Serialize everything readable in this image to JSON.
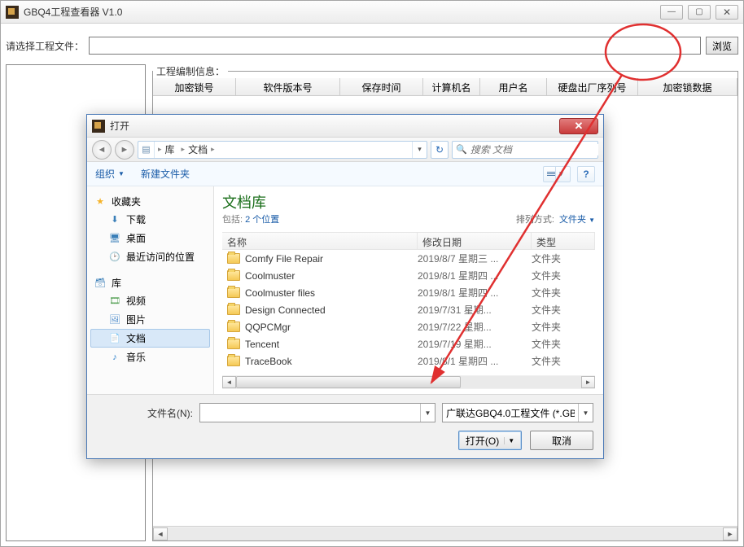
{
  "app": {
    "title": "GBQ4工程查看器 V1.0",
    "pick_label": "请选择工程文件：",
    "pick_value": "",
    "browse": "浏览"
  },
  "info_legend": "工程编制信息：",
  "grid_headers": [
    "加密锁号",
    "软件版本号",
    "保存时间",
    "计算机名",
    "用户名",
    "硬盘出厂序列号",
    "加密锁数据"
  ],
  "dialog": {
    "title": "打开",
    "breadcrumb": {
      "root": "库",
      "current": "文档"
    },
    "search_placeholder": "搜索 文档",
    "organize": "组织",
    "new_folder": "新建文件夹",
    "nav": {
      "favorites": "收藏夹",
      "downloads": "下载",
      "desktop": "桌面",
      "recent": "最近访问的位置",
      "libraries": "库",
      "videos": "视频",
      "pictures": "图片",
      "documents": "文档",
      "music": "音乐"
    },
    "lib_title": "文档库",
    "lib_sub_prefix": "包括: ",
    "lib_sub_link": "2 个位置",
    "sort_label": "排列方式:",
    "sort_value": "文件夹",
    "columns": [
      "名称",
      "修改日期",
      "类型"
    ],
    "files": [
      {
        "name": "Comfy File Repair",
        "date": "2019/8/7 星期三 ...",
        "type": "文件夹"
      },
      {
        "name": "Coolmuster",
        "date": "2019/8/1 星期四 ...",
        "type": "文件夹"
      },
      {
        "name": "Coolmuster files",
        "date": "2019/8/1 星期四 ...",
        "type": "文件夹"
      },
      {
        "name": "Design Connected",
        "date": "2019/7/31 星期...",
        "type": "文件夹"
      },
      {
        "name": "QQPCMgr",
        "date": "2019/7/22 星期...",
        "type": "文件夹"
      },
      {
        "name": "Tencent",
        "date": "2019/7/19 星期...",
        "type": "文件夹"
      },
      {
        "name": "TraceBook",
        "date": "2019/8/1 星期四 ...",
        "type": "文件夹"
      }
    ],
    "filename_label": "文件名(N):",
    "filename_value": "",
    "filetype_value": "广联达GBQ4.0工程文件 (*.GB(",
    "open_btn": "打开(O)",
    "cancel_btn": "取消"
  }
}
